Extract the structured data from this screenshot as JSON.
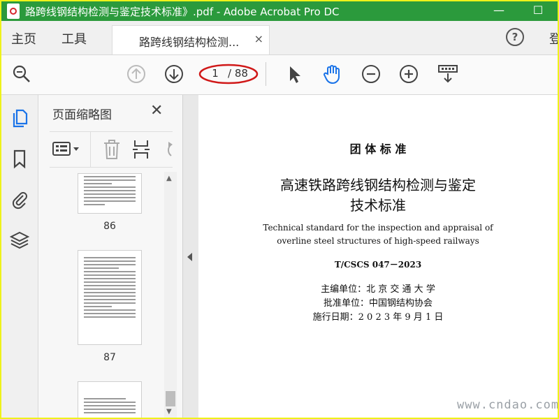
{
  "window": {
    "title": "路跨线钢结构检测与鉴定技术标准》.pdf - Adobe Acrobat Pro DC",
    "minimize_icon": "minimize-icon",
    "maximize_icon": "maximize-icon"
  },
  "menu": {
    "home": "主页",
    "tools": "工具",
    "doc_tab": "路跨线钢结构检测...",
    "doc_tab_close": "×",
    "help": "?",
    "signin": "登"
  },
  "toolbar": {
    "current_page": "1",
    "total_pages": "/ 88",
    "icons": [
      "search-icon",
      "page-up-icon",
      "page-down-icon",
      "select-arrow-icon",
      "hand-icon",
      "zoom-out-icon",
      "zoom-in-icon",
      "scroll-mode-icon"
    ]
  },
  "rail": {
    "icons": [
      "page-thumbnails-icon",
      "bookmarks-icon",
      "attachments-icon",
      "layers-icon"
    ]
  },
  "panel": {
    "title": "页面缩略图",
    "close": "✕",
    "thumbnails": [
      {
        "label": "86"
      },
      {
        "label": "87"
      },
      {
        "label": ""
      }
    ]
  },
  "document": {
    "category": "团 体 标 准",
    "title_line1": "高速铁路跨线钢结构检测与鉴定",
    "title_line2": "技术标准",
    "en_line1": "Technical standard for the inspection and appraisal of",
    "en_line2": "overline steel structures of high-speed railways",
    "code": "T/CSCS 047－2023",
    "editor": "主编单位：北 京 交 通 大 学",
    "approver": "批准单位：中国钢结构协会",
    "effective": "施行日期：2 0 2 3 年 9 月 1 日"
  },
  "watermark": "www.cndao.com",
  "colors": {
    "titlebar": "#2b9a3c",
    "accent_blue": "#1a73e8",
    "highlight_ring": "#d01818"
  }
}
